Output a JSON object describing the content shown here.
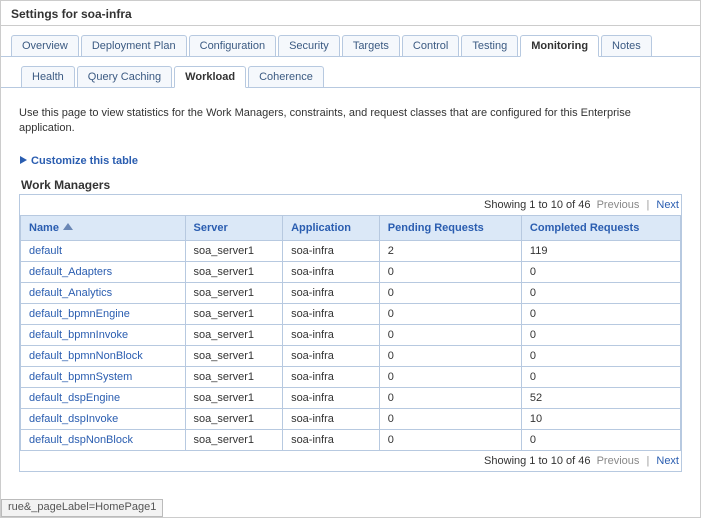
{
  "title": "Settings for soa-infra",
  "tabs": [
    "Overview",
    "Deployment Plan",
    "Configuration",
    "Security",
    "Targets",
    "Control",
    "Testing",
    "Monitoring",
    "Notes"
  ],
  "active_tab": 7,
  "subtabs": [
    "Health",
    "Query Caching",
    "Workload",
    "Coherence"
  ],
  "active_subtab": 2,
  "description": "Use this page to view statistics for the Work Managers, constraints, and request classes that are configured for this Enterprise application.",
  "customize_label": "Customize this table",
  "section_title": "Work Managers",
  "pager": {
    "text": "Showing 1 to 10 of 46",
    "prev": "Previous",
    "next": "Next"
  },
  "columns": [
    "Name",
    "Server",
    "Application",
    "Pending Requests",
    "Completed Requests"
  ],
  "sort_col": 0,
  "rows": [
    {
      "name": "default",
      "server": "soa_server1",
      "app": "soa-infra",
      "pending": "2",
      "completed": "119"
    },
    {
      "name": "default_Adapters",
      "server": "soa_server1",
      "app": "soa-infra",
      "pending": "0",
      "completed": "0"
    },
    {
      "name": "default_Analytics",
      "server": "soa_server1",
      "app": "soa-infra",
      "pending": "0",
      "completed": "0"
    },
    {
      "name": "default_bpmnEngine",
      "server": "soa_server1",
      "app": "soa-infra",
      "pending": "0",
      "completed": "0"
    },
    {
      "name": "default_bpmnInvoke",
      "server": "soa_server1",
      "app": "soa-infra",
      "pending": "0",
      "completed": "0"
    },
    {
      "name": "default_bpmnNonBlock",
      "server": "soa_server1",
      "app": "soa-infra",
      "pending": "0",
      "completed": "0"
    },
    {
      "name": "default_bpmnSystem",
      "server": "soa_server1",
      "app": "soa-infra",
      "pending": "0",
      "completed": "0"
    },
    {
      "name": "default_dspEngine",
      "server": "soa_server1",
      "app": "soa-infra",
      "pending": "0",
      "completed": "52"
    },
    {
      "name": "default_dspInvoke",
      "server": "soa_server1",
      "app": "soa-infra",
      "pending": "0",
      "completed": "10"
    },
    {
      "name": "default_dspNonBlock",
      "server": "soa_server1",
      "app": "soa-infra",
      "pending": "0",
      "completed": "0"
    }
  ],
  "status_bar": "rue&_pageLabel=HomePage1"
}
